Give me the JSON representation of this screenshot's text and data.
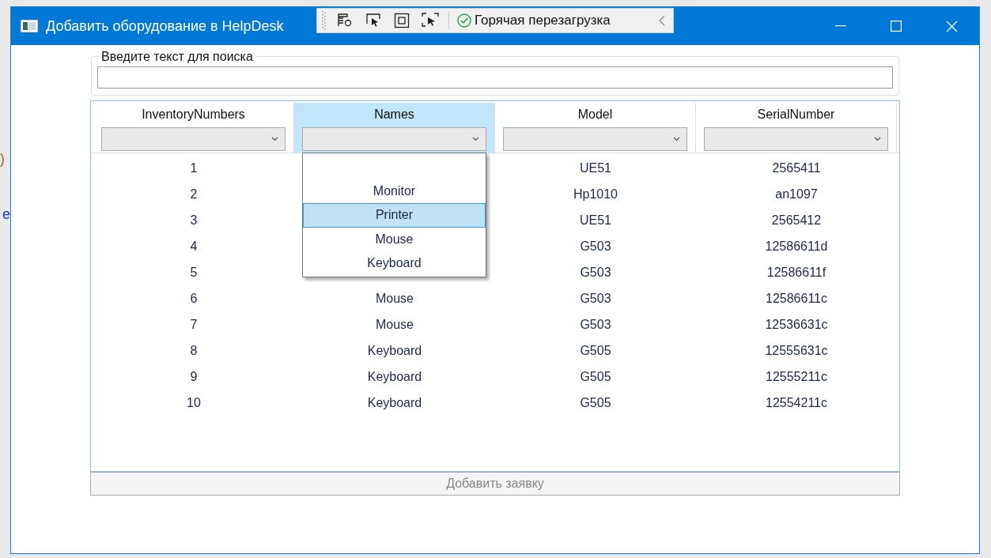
{
  "window": {
    "title": "Добавить оборудование в HelpDesk"
  },
  "debug_toolbar": {
    "hot_reload_label": "Горячая перезагрузка"
  },
  "background_fragments": [
    ")",
    "e"
  ],
  "search": {
    "label": "Введите текст для поиска"
  },
  "table": {
    "columns": [
      {
        "header": "InventoryNumbers",
        "selected": false
      },
      {
        "header": "Names",
        "selected": true
      },
      {
        "header": "Model",
        "selected": false
      },
      {
        "header": "SerialNumber",
        "selected": false
      }
    ],
    "rows": [
      {
        "inventory_number": "1",
        "model": "UE51",
        "serial_number": "2565411"
      },
      {
        "inventory_number": "2",
        "model": "Hp1010",
        "serial_number": "an1097"
      },
      {
        "inventory_number": "3",
        "model": "UE51",
        "serial_number": "2565412"
      },
      {
        "inventory_number": "4",
        "model": "G503",
        "serial_number": "12586611d"
      },
      {
        "inventory_number": "5",
        "model": "G503",
        "serial_number": "12586611f"
      },
      {
        "inventory_number": "6",
        "name": "Mouse",
        "model": "G503",
        "serial_number": "12586611c"
      },
      {
        "inventory_number": "7",
        "name": "Mouse",
        "model": "G503",
        "serial_number": "12536631c"
      },
      {
        "inventory_number": "8",
        "name": "Keyboard",
        "model": "G505",
        "serial_number": "12555631c"
      },
      {
        "inventory_number": "9",
        "name": "Keyboard",
        "model": "G505",
        "serial_number": "12555211c"
      },
      {
        "inventory_number": "10",
        "name": "Keyboard",
        "model": "G505",
        "serial_number": "12554211c"
      }
    ]
  },
  "names_dropdown": {
    "items": [
      {
        "kind": "option",
        "label": "Monitor",
        "selected": false
      },
      {
        "kind": "option",
        "label": "Printer",
        "selected": true
      },
      {
        "kind": "option",
        "label": "Mouse",
        "selected": false
      },
      {
        "kind": "option",
        "label": "Keyboard",
        "selected": false
      }
    ]
  },
  "submit_button": {
    "label": "Добавить заявку",
    "disabled": true
  }
}
